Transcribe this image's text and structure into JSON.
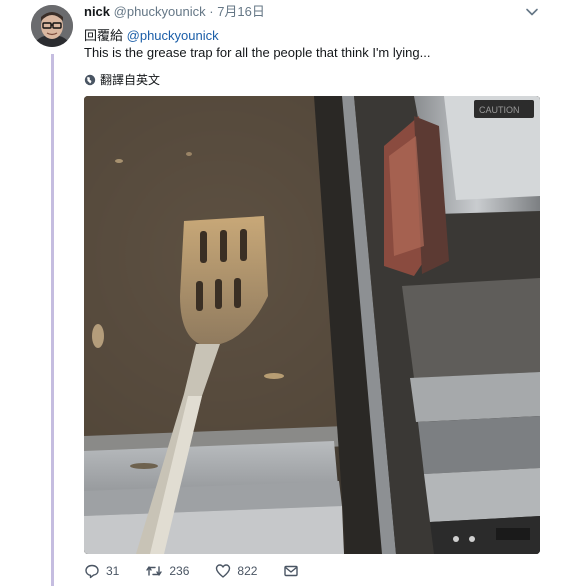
{
  "tweet": {
    "author_name": "nick",
    "author_handle": "@phuckyounick",
    "separator": "·",
    "date": "7月16日",
    "reply_prefix": "回覆給",
    "reply_mention": "@phuckyounick",
    "text": "This is the grease trap for all the people that think I'm lying...",
    "translate_label": "翻譯自英文",
    "image_label": "CAUTION"
  },
  "actions": {
    "reply_count": "31",
    "retweet_count": "236",
    "like_count": "822"
  },
  "icons": {
    "avatar": "avatar-photo",
    "menu": "chevron-down-icon",
    "translate": "globe-icon",
    "reply": "reply-icon",
    "retweet": "retweet-icon",
    "like": "heart-icon",
    "dm": "envelope-icon"
  },
  "colors": {
    "thread_line": "#c5bde0",
    "link": "#1b5ea8",
    "muted": "#657786"
  }
}
